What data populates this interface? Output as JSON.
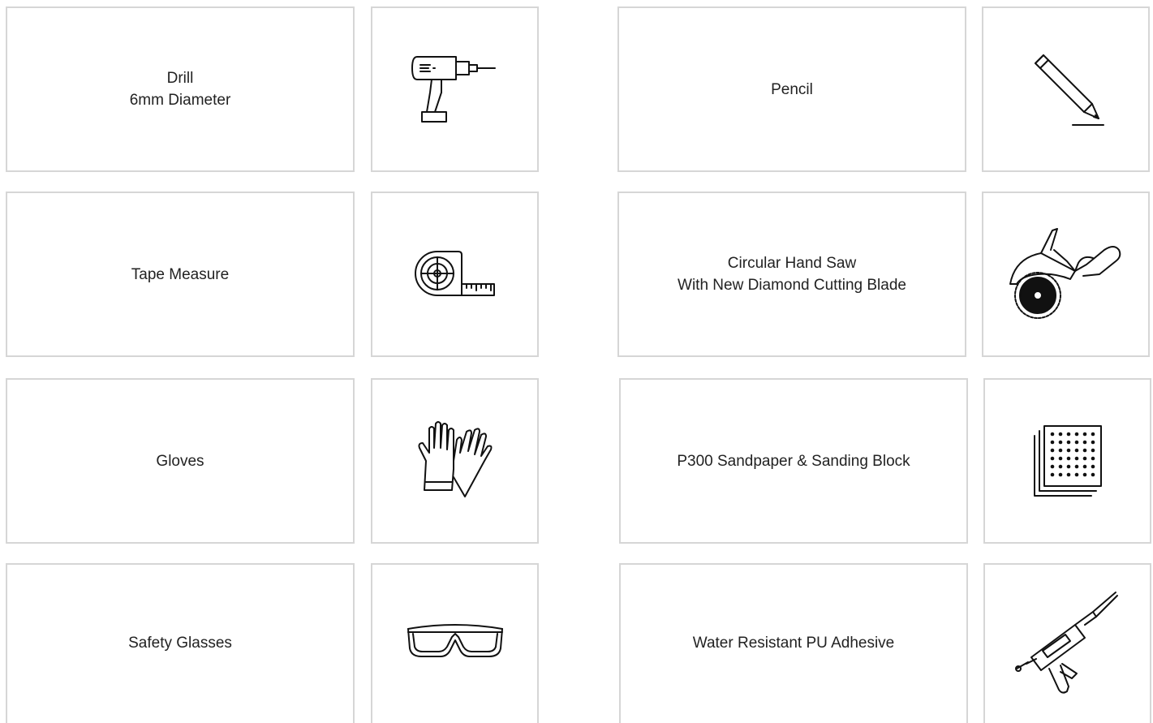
{
  "tools": {
    "drill": {
      "line1": "Drill",
      "line2": "6mm Diameter",
      "icon": "drill-icon"
    },
    "pencil": {
      "line1": "Pencil",
      "icon": "pencil-icon"
    },
    "tape_measure": {
      "line1": "Tape Measure",
      "icon": "tape-measure-icon"
    },
    "saw": {
      "line1": "Circular Hand Saw",
      "line2": "With New Diamond Cutting Blade",
      "icon": "circular-saw-icon"
    },
    "gloves": {
      "line1": "Gloves",
      "icon": "gloves-icon"
    },
    "sandpaper": {
      "line1": "P300 Sandpaper & Sanding Block",
      "icon": "sandpaper-icon"
    },
    "glasses": {
      "line1": "Safety Glasses",
      "icon": "safety-glasses-icon"
    },
    "adhesive": {
      "line1": "Water Resistant PU Adhesive",
      "icon": "caulking-gun-icon"
    }
  },
  "colors": {
    "border": "#d6d6d6",
    "text": "#222222",
    "icon_stroke": "#111111"
  }
}
